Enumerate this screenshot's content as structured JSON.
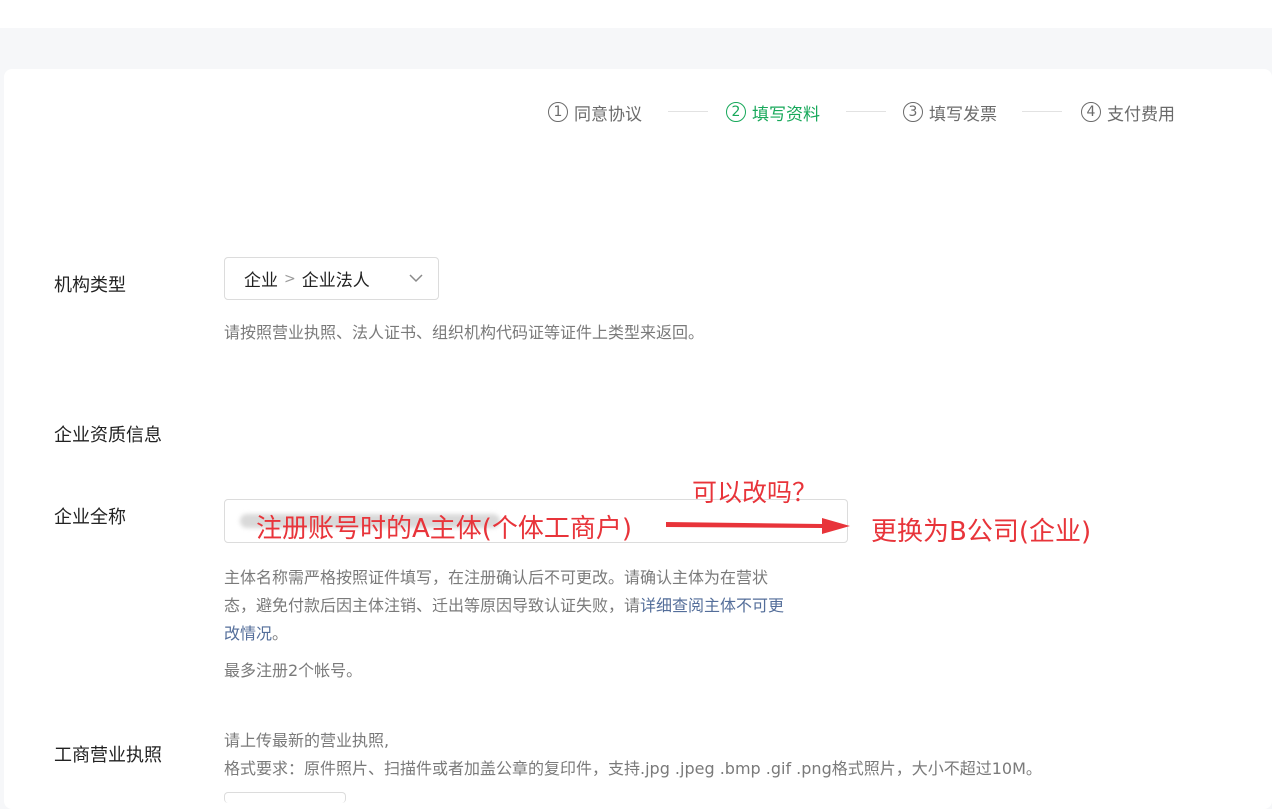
{
  "steps": [
    {
      "num": "1",
      "label": "同意协议"
    },
    {
      "num": "2",
      "label": "填写资料"
    },
    {
      "num": "3",
      "label": "填写发票"
    },
    {
      "num": "4",
      "label": "支付费用"
    }
  ],
  "org_type": {
    "label": "机构类型",
    "selected_primary": "企业",
    "selected_secondary": "企业法人",
    "hint": "请按照营业执照、法人证书、组织机构代码证等证件上类型来返回。"
  },
  "section_title": "企业资质信息",
  "company_name": {
    "label": "企业全称",
    "hint_line1": "主体名称需严格按照证件填写，在注册确认后不可更改。请确认主体为在营状",
    "hint_line2_prefix": "态，避免付款后因主体注销、迁出等原因导致认证失败，请",
    "hint_link_part1": "详细查阅主体不可更",
    "hint_link_part2": "改情况",
    "hint_line3_suffix": "。",
    "limit_hint": "最多注册2个帐号。"
  },
  "business_license": {
    "label": "工商营业执照",
    "hint_line1": "请上传最新的营业执照,",
    "hint_line2": "格式要求：原件照片、扫描件或者加盖公章的复印件，支持.jpg .jpeg .bmp .gif .png格式照片，大小不超过10M。"
  },
  "annotations": {
    "input_note": "注册账号时的A主体(个体工商户)",
    "question": "可以改吗？",
    "target": "更换为B公司(企业)",
    "color": "#e8343a"
  },
  "colors": {
    "active_step": "#17a85a",
    "inactive_step": "#6b6b6b",
    "link": "#546e9a"
  }
}
